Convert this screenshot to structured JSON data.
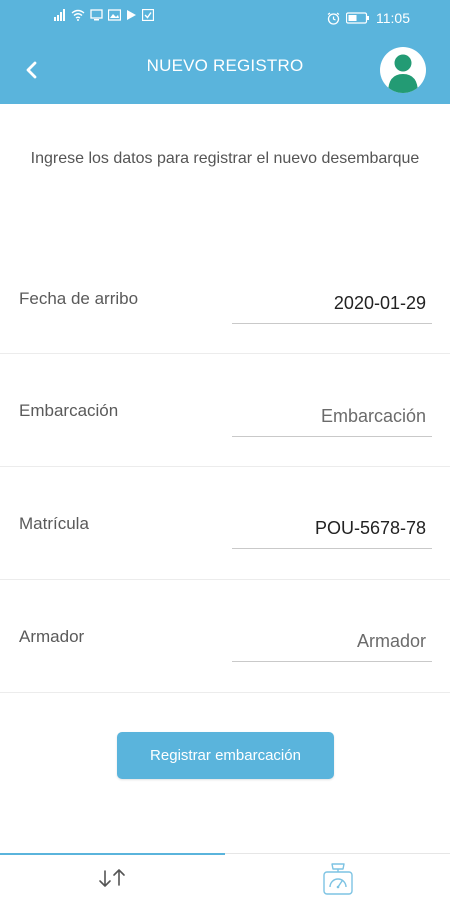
{
  "status_bar": {
    "time": "11:05"
  },
  "header": {
    "title": "NUEVO REGISTRO",
    "back_icon": "chevron-left-icon",
    "avatar_icon": "user-icon"
  },
  "instruction": "Ingrese los datos para registrar el nuevo desembarque",
  "form": {
    "fecha": {
      "label": "Fecha de arribo",
      "value": "2020-01-29"
    },
    "embarcacion": {
      "label": "Embarcación",
      "placeholder": "Embarcación"
    },
    "matricula": {
      "label": "Matrícula",
      "value": "POU-5678-78"
    },
    "armador": {
      "label": "Armador",
      "placeholder": "Armador"
    }
  },
  "register_button": {
    "label": "Registrar embarcación"
  },
  "bottom_nav": {
    "tabs": [
      {
        "icon": "transfer-arrows-icon",
        "selected": true
      },
      {
        "icon": "scale-icon",
        "selected": false
      }
    ]
  },
  "colors": {
    "primary": "#5ab4dc",
    "avatar_bg": "#ffffff",
    "avatar_figure": "#239b74"
  }
}
